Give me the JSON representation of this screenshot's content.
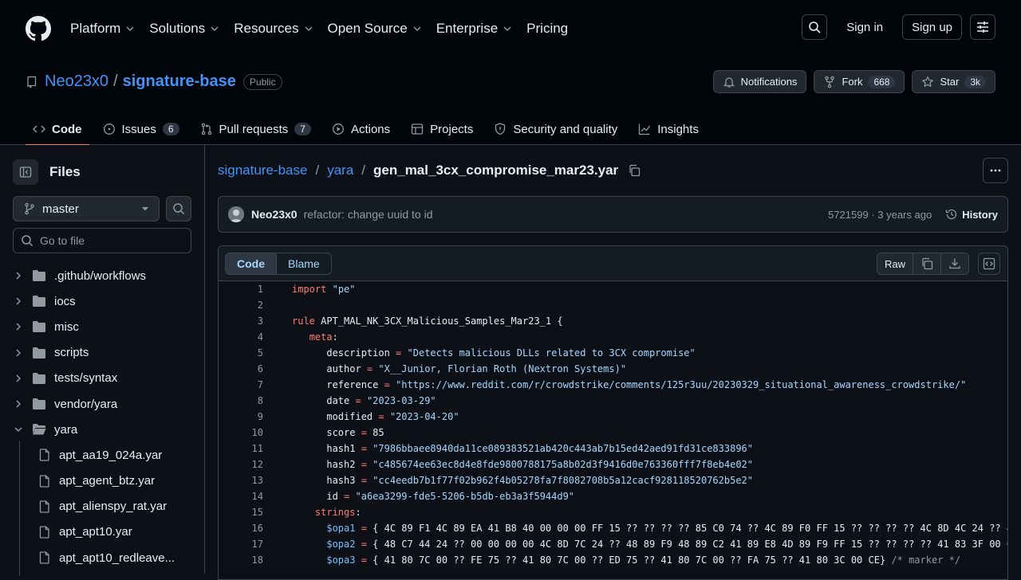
{
  "header": {
    "nav": [
      {
        "label": "Platform",
        "chevron": true
      },
      {
        "label": "Solutions",
        "chevron": true
      },
      {
        "label": "Resources",
        "chevron": true
      },
      {
        "label": "Open Source",
        "chevron": true
      },
      {
        "label": "Enterprise",
        "chevron": true
      },
      {
        "label": "Pricing",
        "chevron": false
      }
    ],
    "sign_in": "Sign in",
    "sign_up": "Sign up"
  },
  "repo": {
    "owner": "Neo23x0",
    "separator": "/",
    "name": "signature-base",
    "visibility": "Public",
    "notifications": "Notifications",
    "fork_label": "Fork",
    "fork_count": "668",
    "star_label": "Star",
    "star_count": "3k"
  },
  "tabs": [
    {
      "label": "Code",
      "count": ""
    },
    {
      "label": "Issues",
      "count": "6"
    },
    {
      "label": "Pull requests",
      "count": "7"
    },
    {
      "label": "Actions",
      "count": ""
    },
    {
      "label": "Projects",
      "count": ""
    },
    {
      "label": "Security and quality",
      "count": ""
    },
    {
      "label": "Insights",
      "count": ""
    }
  ],
  "sidebar": {
    "title": "Files",
    "branch": "master",
    "go_to_file_placeholder": "Go to file",
    "tree": [
      {
        "label": ".github/workflows",
        "type": "folder",
        "expanded": false
      },
      {
        "label": "iocs",
        "type": "folder",
        "expanded": false
      },
      {
        "label": "misc",
        "type": "folder",
        "expanded": false
      },
      {
        "label": "scripts",
        "type": "folder",
        "expanded": false
      },
      {
        "label": "tests/syntax",
        "type": "folder",
        "expanded": false
      },
      {
        "label": "vendor/yara",
        "type": "folder",
        "expanded": false
      },
      {
        "label": "yara",
        "type": "folder",
        "expanded": true
      },
      {
        "label": "apt_aa19_024a.yar",
        "type": "file"
      },
      {
        "label": "apt_agent_btz.yar",
        "type": "file"
      },
      {
        "label": "apt_alienspy_rat.yar",
        "type": "file"
      },
      {
        "label": "apt_apt10.yar",
        "type": "file"
      },
      {
        "label": "apt_apt10_redleave...",
        "type": "file"
      }
    ]
  },
  "breadcrumb": {
    "repo": "signature-base",
    "folder": "yara",
    "file": "gen_mal_3cx_compromise_mar23.yar",
    "slash": "/"
  },
  "commit": {
    "author": "Neo23x0",
    "message": "refactor: change uuid to id",
    "meta": "5721599 · 3 years ago",
    "history": "History"
  },
  "code_toolbar": {
    "code": "Code",
    "blame": "Blame",
    "raw": "Raw"
  },
  "code_lines": [
    {
      "n": "1",
      "text": "import \"pe\""
    },
    {
      "n": "2",
      "text": ""
    },
    {
      "n": "3",
      "text": "rule APT_MAL_NK_3CX_Malicious_Samples_Mar23_1 {"
    },
    {
      "n": "4",
      "text": "   meta:"
    },
    {
      "n": "5",
      "text": "      description = \"Detects malicious DLLs related to 3CX compromise\""
    },
    {
      "n": "6",
      "text": "      author = \"X__Junior, Florian Roth (Nextron Systems)\""
    },
    {
      "n": "7",
      "text": "      reference = \"https://www.reddit.com/r/crowdstrike/comments/125r3uu/20230329_situational_awareness_crowdstrike/\""
    },
    {
      "n": "8",
      "text": "      date = \"2023-03-29\""
    },
    {
      "n": "9",
      "text": "      modified = \"2023-04-20\""
    },
    {
      "n": "10",
      "text": "      score = 85"
    },
    {
      "n": "11",
      "text": "      hash1 = \"7986bbaee8940da11ce089383521ab420c443ab7b15ed42aed91fd31ce833896\""
    },
    {
      "n": "12",
      "text": "      hash2 = \"c485674ee63ec8d4e8fde9800788175a8b02d3f9416d0e763360fff7f8eb4e02\""
    },
    {
      "n": "13",
      "text": "      hash3 = \"cc4eedb7b1f77f02b962f4b05278fa7f8082708b5a12cacf928118520762b5e2\""
    },
    {
      "n": "14",
      "text": "      id = \"a6ea3299-fde5-5206-b5db-eb3a3f5944d9\""
    },
    {
      "n": "15",
      "text": "    strings:"
    },
    {
      "n": "16",
      "text": "      $opa1 = { 4C 89 F1 4C 89 EA 41 B8 40 00 00 00 FF 15 ?? ?? ?? ?? 85 C0 74 ?? 4C 89 F0 FF 15 ?? ?? ?? ?? 4C 8D 4C 24 ?? 4"
    },
    {
      "n": "17",
      "text": "      $opa2 = { 48 C7 44 24 ?? 00 00 00 00 4C 8D 7C 24 ?? 48 89 F9 48 89 C2 41 89 E8 4D 89 F9 FF 15 ?? ?? ?? ?? 41 83 3F 00 0"
    },
    {
      "n": "18",
      "text": "      $opa3 = { 41 80 7C 00 ?? FE 75 ?? 41 80 7C 00 ?? ED 75 ?? 41 80 7C 00 ?? FA 75 ?? 41 80 3C 00 CE} /* marker */"
    }
  ]
}
